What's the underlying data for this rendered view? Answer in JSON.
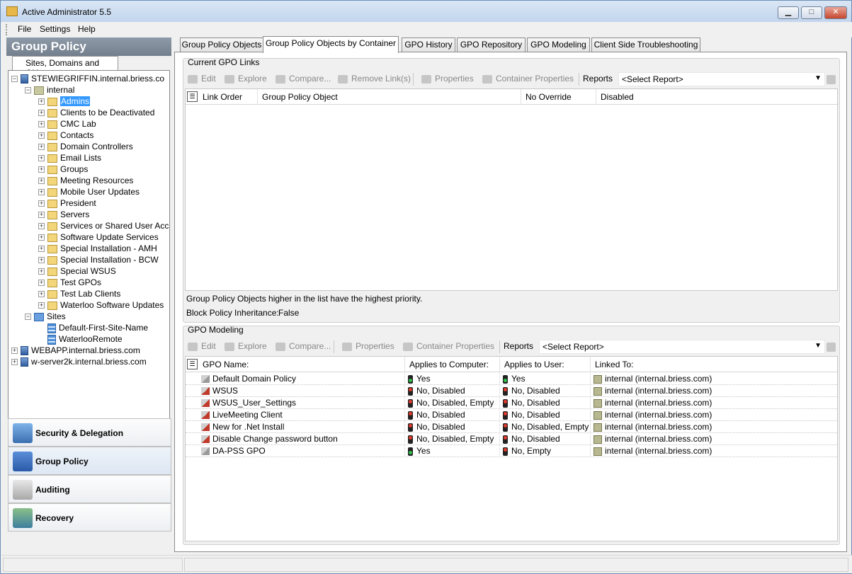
{
  "window": {
    "title": "Active Administrator 5.5",
    "minimize": "▁",
    "maximize": "□",
    "close": "✕"
  },
  "menu": [
    "File",
    "Settings",
    "Help"
  ],
  "left": {
    "header": "Group Policy",
    "tab": "Sites, Domains and OUs",
    "tree": {
      "root": "STEWIEGRIFFIN.internal.briess.co",
      "domain": "internal",
      "ous": [
        "Admins",
        "Clients to be Deactivated",
        "CMC Lab",
        "Contacts",
        "Domain Controllers",
        "Email Lists",
        "Groups",
        "Meeting Resources",
        "Mobile User Updates",
        "President",
        "Servers",
        "Services or Shared User Acc",
        "Software Update Services",
        "Special Installation - AMH",
        "Special Installation - BCW",
        "Special WSUS",
        "Test GPOs",
        "Test Lab Clients",
        "Waterloo Software Updates"
      ],
      "sites_label": "Sites",
      "sites": [
        "Default-First-Site-Name",
        "WaterlooRemote"
      ],
      "other_servers": [
        "WEBAPP.internal.briess.com",
        "w-server2k.internal.briess.com"
      ]
    },
    "splitter": "••••••••••",
    "nav": [
      {
        "label": "Security & Delegation",
        "icon": "security-icon"
      },
      {
        "label": "Group Policy",
        "icon": "group-policy-icon"
      },
      {
        "label": "Auditing",
        "icon": "auditing-icon"
      },
      {
        "label": "Recovery",
        "icon": "recovery-icon"
      }
    ]
  },
  "tabs": [
    "Group Policy Objects",
    "Group Policy Objects by Container",
    "GPO History",
    "GPO Repository",
    "GPO Modeling",
    "Client Side Troubleshooting"
  ],
  "links": {
    "title": "Current GPO Links",
    "toolbar": {
      "edit": "Edit",
      "explore": "Explore",
      "compare": "Compare...",
      "remove": "Remove Link(s)",
      "properties": "Properties",
      "container_properties": "Container Properties",
      "reports": "Reports",
      "select_report": "<Select Report>"
    },
    "columns": [
      "Link Order",
      "Group Policy Object",
      "No Override",
      "Disabled"
    ],
    "priority_note": "Group Policy Objects higher in the list have the highest priority.",
    "block_label": "Block Policy Inheritance:",
    "block_value": "False"
  },
  "modeling": {
    "title": "GPO Modeling",
    "toolbar": {
      "edit": "Edit",
      "explore": "Explore",
      "compare": "Compare...",
      "properties": "Properties",
      "container_properties": "Container Properties",
      "reports": "Reports",
      "select_report": "<Select Report>"
    },
    "columns": [
      "GPO Name:",
      "Applies to Computer:",
      "Applies to User:",
      "Linked To:"
    ],
    "rows": [
      {
        "name": "Default Domain Policy",
        "computer": "Yes",
        "computer_status": "green",
        "user": "Yes",
        "user_status": "green",
        "linked": "internal (internal.briess.com)",
        "gpo_state": "enabled"
      },
      {
        "name": "WSUS",
        "computer": "No, Disabled",
        "computer_status": "red",
        "user": "No, Disabled",
        "user_status": "red",
        "linked": "internal (internal.briess.com)",
        "gpo_state": "disabled"
      },
      {
        "name": "WSUS_User_Settings",
        "computer": "No, Disabled, Empty",
        "computer_status": "red",
        "user": "No, Disabled",
        "user_status": "red",
        "linked": "internal (internal.briess.com)",
        "gpo_state": "disabled"
      },
      {
        "name": "LiveMeeting Client",
        "computer": "No, Disabled",
        "computer_status": "red",
        "user": "No, Disabled",
        "user_status": "red",
        "linked": "internal (internal.briess.com)",
        "gpo_state": "disabled"
      },
      {
        "name": "New for .Net Install",
        "computer": "No, Disabled",
        "computer_status": "red",
        "user": "No, Disabled, Empty",
        "user_status": "red",
        "linked": "internal (internal.briess.com)",
        "gpo_state": "disabled"
      },
      {
        "name": "Disable Change password button",
        "computer": "No, Disabled, Empty",
        "computer_status": "red",
        "user": "No, Disabled",
        "user_status": "red",
        "linked": "internal (internal.briess.com)",
        "gpo_state": "disabled"
      },
      {
        "name": "DA-PSS GPO",
        "computer": "Yes",
        "computer_status": "green",
        "user": "No, Empty",
        "user_status": "red",
        "linked": "internal (internal.briess.com)",
        "gpo_state": "enabled"
      }
    ]
  }
}
